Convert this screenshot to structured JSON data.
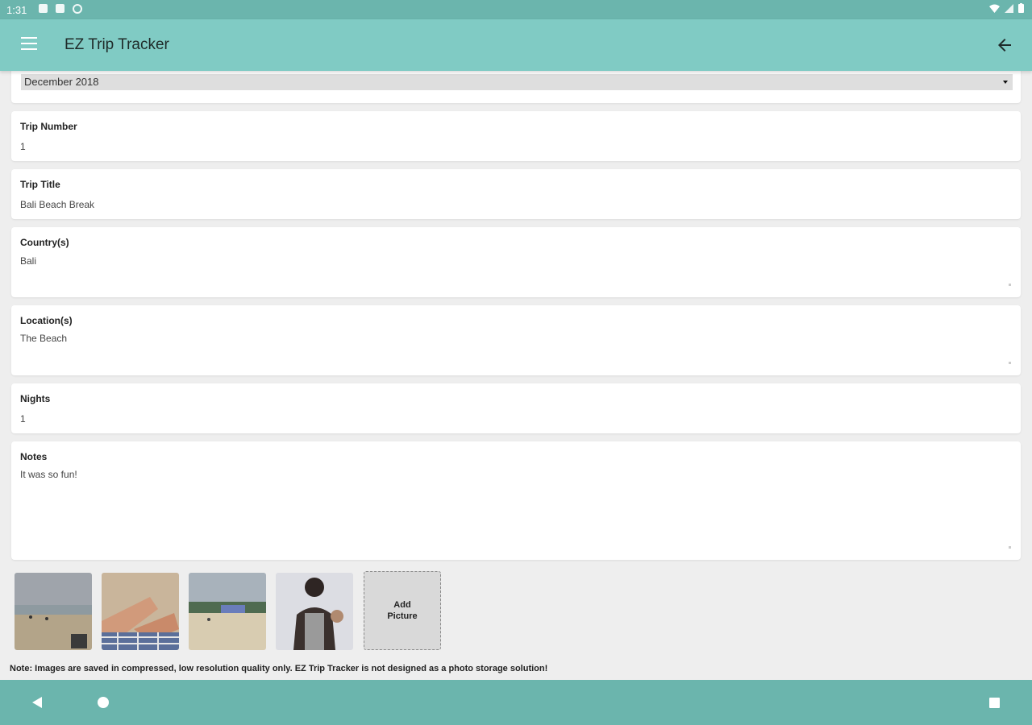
{
  "status_bar": {
    "time": "1:31",
    "icons": [
      "notification-icon",
      "sd-card-icon",
      "sync-icon"
    ],
    "right_icons": [
      "wifi-icon",
      "signal-icon",
      "battery-icon"
    ]
  },
  "app_bar": {
    "title": "EZ Trip Tracker"
  },
  "form": {
    "month_select": "December 2018",
    "trip_number": {
      "label": "Trip Number",
      "value": "1"
    },
    "trip_title": {
      "label": "Trip Title",
      "value": "Bali Beach Break"
    },
    "countries": {
      "label": "Country(s)",
      "value": "Bali"
    },
    "locations": {
      "label": "Location(s)",
      "value": "The Beach"
    },
    "nights": {
      "label": "Nights",
      "value": "1"
    },
    "notes": {
      "label": "Notes",
      "value": "It was so fun!"
    }
  },
  "pictures": {
    "add_label": "Add Picture"
  },
  "note": "Note: Images are saved in compressed, low resolution quality only. EZ Trip Tracker is not designed as a photo storage solution!",
  "colors": {
    "status_bar": "#6bb5ad",
    "app_bar": "#80cbc4",
    "nav_bar": "#6bb5ad",
    "background": "#eeeeee"
  }
}
